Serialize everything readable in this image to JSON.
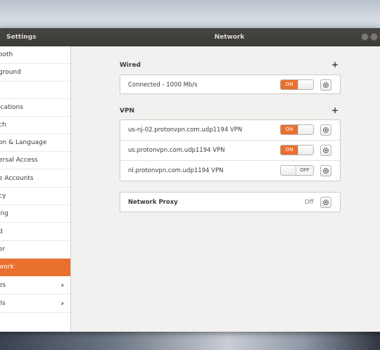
{
  "window": {
    "app_title": "Settings",
    "panel_title": "Network"
  },
  "sidebar": {
    "items": [
      {
        "label": "ooth"
      },
      {
        "label": "ground"
      },
      {
        "label": ""
      },
      {
        "label": "ications"
      },
      {
        "label": "ch"
      },
      {
        "label": "on & Language"
      },
      {
        "label": "ersal Access"
      },
      {
        "label": "e Accounts"
      },
      {
        "label": "cy"
      },
      {
        "label": "ing"
      },
      {
        "label": "d"
      },
      {
        "label": "er"
      },
      {
        "label": "work"
      },
      {
        "label": "es"
      },
      {
        "label": "ils"
      }
    ]
  },
  "wired": {
    "section_title": "Wired",
    "add_label": "+",
    "connection": {
      "name": "Connected - 1000 Mb/s",
      "toggle_label": "ON"
    }
  },
  "vpn": {
    "section_title": "VPN",
    "add_label": "+",
    "connections": [
      {
        "name": "us-nj-02.protonvpn.com.udp1194 VPN",
        "toggle_label": "ON"
      },
      {
        "name": "us.protonvpn.com.udp1194 VPN",
        "toggle_label": "ON"
      },
      {
        "name": "nl.protonvpn.com.udp1194 VPN",
        "toggle_label": "OFF"
      }
    ]
  },
  "proxy": {
    "name": "Network Proxy",
    "status": "Off"
  },
  "icons": {
    "gear": "gear-icon",
    "chevron": "chevron-right-icon"
  },
  "colors": {
    "accent": "#e9702f",
    "titlebar": "#3c3b37",
    "close_button": "#e8572b"
  }
}
